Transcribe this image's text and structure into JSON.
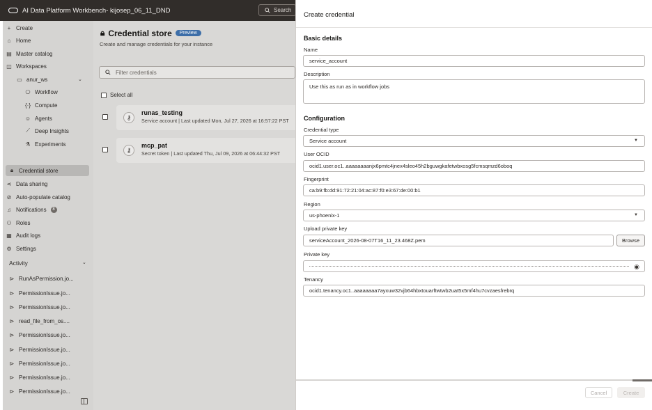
{
  "app": {
    "title": "AI Data Platform Workbench- kijosep_06_11_DND",
    "search_placeholder": "Search"
  },
  "sidebar": {
    "top_items": [
      {
        "label": "Create",
        "icon": "plus-icon"
      },
      {
        "label": "Home",
        "icon": "home-icon"
      },
      {
        "label": "Master catalog",
        "icon": "catalog-icon"
      },
      {
        "label": "Workspaces",
        "icon": "workspaces-icon"
      }
    ],
    "workspace": {
      "label": "anur_ws",
      "icon": "folder-icon"
    },
    "workspace_items": [
      {
        "label": "Workflow",
        "icon": "workflow-icon"
      },
      {
        "label": "Compute",
        "icon": "compute-icon"
      },
      {
        "label": "Agents",
        "icon": "agents-icon"
      },
      {
        "label": "Deep Insights",
        "icon": "insights-icon"
      },
      {
        "label": "Experiments",
        "icon": "experiments-icon"
      }
    ],
    "bottom_items": [
      {
        "label": "Credential store",
        "icon": "lock-icon",
        "active": true
      },
      {
        "label": "Data sharing",
        "icon": "share-icon"
      },
      {
        "label": "Auto-populate catalog",
        "icon": "auto-populate-icon"
      },
      {
        "label": "Notifications",
        "icon": "bell-icon",
        "count": "8"
      },
      {
        "label": "Roles",
        "icon": "roles-icon"
      },
      {
        "label": "Audit logs",
        "icon": "audit-icon"
      },
      {
        "label": "Settings",
        "icon": "gear-icon"
      }
    ],
    "activity_title": "Activity",
    "activity_items": [
      "RunAsPermission.jo...",
      "PermissionIssue.jo...",
      "PermissionIssue.jo...",
      "read_file_from_os....",
      "PermissionIssue.jo...",
      "PermissionIssue.jo...",
      "PermissionIssue.jo...",
      "PermissionIssue.jo...",
      "PermissionIssue.jo..."
    ]
  },
  "main": {
    "title": "Credential store",
    "badge": "Preview",
    "subtitle": "Create and manage credentials for your instance",
    "filter_placeholder": "Filter credentials",
    "select_all": "Select all",
    "credentials": [
      {
        "name": "runas_testing",
        "meta": "Service account | Last updated Mon, Jul 27, 2026 at 16:57:22 PST"
      },
      {
        "name": "mcp_pat",
        "meta": "Secret token | Last updated Thu, Jul 09, 2026 at 06:44:32 PST"
      }
    ]
  },
  "drawer": {
    "title": "Create credential",
    "basic_title": "Basic details",
    "name_label": "Name",
    "name_value": "service_account",
    "description_label": "Description",
    "description_value": "Use this as run as in workflow jobs",
    "config_title": "Configuration",
    "type_label": "Credential type",
    "type_value": "Service account",
    "ocid_label": "User OCID",
    "ocid_value": "ocid1.user.oc1..aaaaaaaanjx6pmtc4jnex4sleo45h2bguwgkafetwbxosg5fcmsqmzd6oboq",
    "fingerprint_label": "Fingerprint",
    "fingerprint_value": "ca:b9:fb:dd:91:72:21:04:ac:87:f0:e3:67:de:00:b1",
    "region_label": "Region",
    "region_value": "us-phoenix-1",
    "upload_label": "Upload private key",
    "upload_value": "serviceAccount_2026-08-07T16_11_23.468Z.pem",
    "browse_label": "Browse",
    "private_key_label": "Private key",
    "tenancy_label": "Tenancy",
    "tenancy_value": "ocid1.tenancy.oc1..aaaaaaaa7ayxuw32vjb64hbxtouarftwtwb2uat5x5mf4hu7cvzaesfrebrq",
    "cancel_label": "Cancel",
    "create_label": "Create"
  }
}
